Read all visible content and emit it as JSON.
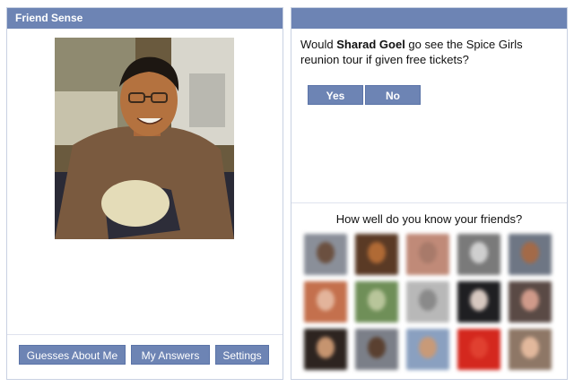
{
  "app": {
    "title": "Friend Sense"
  },
  "left": {
    "buttons": {
      "guesses": "Guesses About Me",
      "answers": "My Answers",
      "settings": "Settings"
    }
  },
  "right": {
    "question": {
      "prefix": "Would ",
      "name": "Sharad Goel",
      "suffix": " go see the Spice Girls reunion tour if given free tickets?"
    },
    "yes_label": "Yes",
    "no_label": "No",
    "friends_title": "How well do you know your friends?"
  },
  "friends": [
    {
      "bg": "#8a8f99",
      "face": "#6b5040"
    },
    {
      "bg": "#5a3a25",
      "face": "#b06a35"
    },
    {
      "bg": "#c08a78",
      "face": "#a87a6a"
    },
    {
      "bg": "#7a7a7a",
      "face": "#cfcfcf"
    },
    {
      "bg": "#6e7684",
      "face": "#a36a48"
    },
    {
      "bg": "#c4704d",
      "face": "#e3b49b"
    },
    {
      "bg": "#6f8f58",
      "face": "#b8c59a"
    },
    {
      "bg": "#b8b8b8",
      "face": "#8a8a8a"
    },
    {
      "bg": "#1f1f22",
      "face": "#d7c8c0"
    },
    {
      "bg": "#5a4a45",
      "face": "#d09a8a"
    },
    {
      "bg": "#2d2420",
      "face": "#c6946f"
    },
    {
      "bg": "#7b7f88",
      "face": "#5a4030"
    },
    {
      "bg": "#8aa0c0",
      "face": "#c89a78"
    },
    {
      "bg": "#d4281e",
      "face": "#e04030"
    },
    {
      "bg": "#8e7766",
      "face": "#e2b89c"
    }
  ]
}
